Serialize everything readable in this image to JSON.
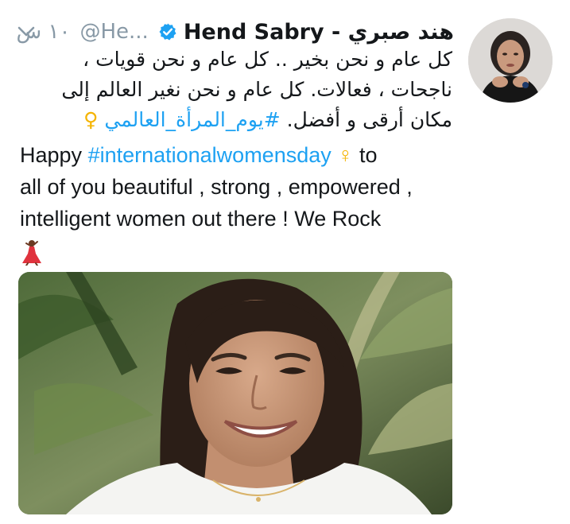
{
  "tweet": {
    "display_name": "Hend Sabry - هند صبري",
    "handle": "@He...",
    "timestamp": "١٠ س",
    "verified_icon": "verified-badge-icon",
    "menu_icon": "chevron-down-icon",
    "text_ar": {
      "line1": "كل عام و نحن بخير .. كل عام و نحن قويات ،",
      "line2": "ناجحات ، فعالات. كل عام و نحن نغير العالم إلى",
      "line3_text": "مكان أرقى و أفضل.",
      "line3_hashtag": "#يوم_المرأة_العالمي",
      "line3_symbol": "♀"
    },
    "text_en": {
      "line1_pre": "Happy ",
      "line1_hashtag": "#internationalwomensday",
      "line1_symbol": "♀",
      "line1_post": " to",
      "line2": "all of you beautiful , strong , empowered ,",
      "line3": "intelligent women out there ! We Rock",
      "line4_emoji": "dancer-icon"
    },
    "media": {
      "icon": "photo-of-smiling-woman"
    },
    "colors": {
      "link": "#1da1f2",
      "muted": "#8899a6",
      "text": "#14171a",
      "verified": "#1da1f2"
    }
  }
}
